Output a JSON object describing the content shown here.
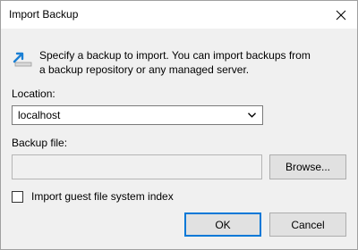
{
  "window": {
    "title": "Import Backup",
    "close_icon": "close-icon"
  },
  "content": {
    "icon": "import-arrow-icon",
    "description_line1": "Specify a backup to import. You can import backups from",
    "description_line2": "a backup repository or any managed server."
  },
  "location": {
    "label": "Location:",
    "selected": "localhost"
  },
  "backup_file": {
    "label": "Backup file:",
    "value": "",
    "browse_label": "Browse..."
  },
  "options": {
    "import_index_label": "Import guest file system index",
    "import_index_checked": false
  },
  "buttons": {
    "ok_label": "OK",
    "cancel_label": "Cancel"
  },
  "colors": {
    "accent": "#0078d7",
    "dialog_background": "#f0f0f0"
  }
}
